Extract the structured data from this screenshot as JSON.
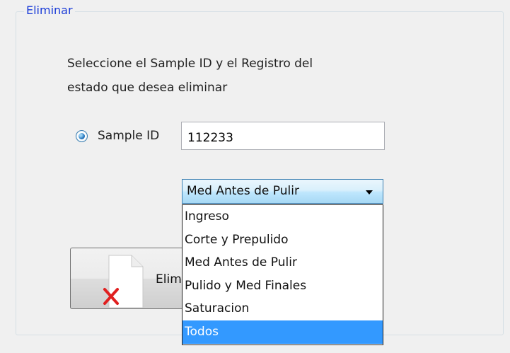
{
  "group": {
    "title": "Eliminar"
  },
  "instructions": {
    "line1": "Seleccione el Sample ID y el Registro del",
    "line2": "estado que desea eliminar"
  },
  "sample_id": {
    "radio_label": "Sample ID",
    "selected": true,
    "value": "112233"
  },
  "estado_combo": {
    "selected": "Med Antes de Pulir",
    "options": [
      {
        "label": "Ingreso"
      },
      {
        "label": "Corte y Prepulido"
      },
      {
        "label": "Med Antes de Pulir"
      },
      {
        "label": "Pulido y Med Finales"
      },
      {
        "label": "Saturacion"
      },
      {
        "label": "Todos"
      }
    ],
    "highlighted": "Todos"
  },
  "delete_button": {
    "label": "Elim",
    "icon": "delete-document-icon"
  },
  "colors": {
    "group_title": "#1a3bd8",
    "highlight": "#3399ff",
    "delete_x": "#e02020"
  }
}
